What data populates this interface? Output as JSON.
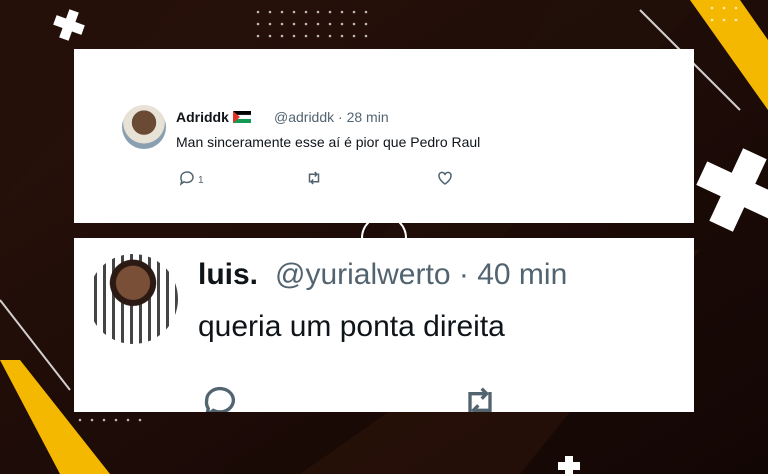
{
  "tweets": [
    {
      "display_name": "Adriddk",
      "flag_icon": "palestine-flag-icon",
      "handle": "@adriddk",
      "separator": "·",
      "time": "28 min",
      "text": "Man sinceramente esse aí é pior que Pedro Raul",
      "reply_count": "1"
    },
    {
      "display_name": "luis.",
      "handle": "@yurialwerto",
      "separator": "·",
      "time": "40 min",
      "text": "queria um ponta direita"
    }
  ],
  "colors": {
    "background": "#1a0b07",
    "accent_yellow": "#f5b800",
    "text_primary": "#0f1419",
    "text_secondary": "#536471"
  }
}
